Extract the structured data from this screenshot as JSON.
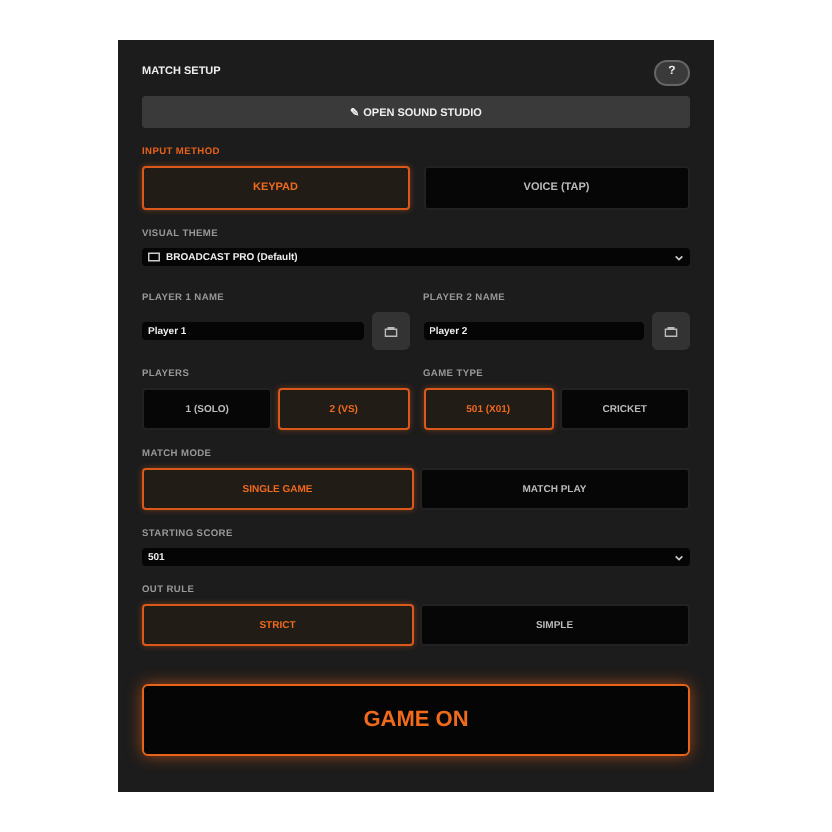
{
  "title": "MATCH SETUP",
  "help_button": "?",
  "sound_button": {
    "icon": "✎",
    "label": "OPEN SOUND STUDIO"
  },
  "input_method": {
    "label": "INPUT METHOD",
    "options": [
      {
        "label": "KEYPAD",
        "selected": true
      },
      {
        "label": "VOICE (TAP)",
        "selected": false
      }
    ]
  },
  "visual_theme": {
    "label": "VISUAL THEME",
    "value": "BROADCAST PRO (Default)"
  },
  "player_names": [
    {
      "label": "PLAYER 1 NAME",
      "value": "Player 1"
    },
    {
      "label": "PLAYER 2 NAME",
      "value": "Player 2"
    }
  ],
  "players": {
    "label": "PLAYERS",
    "options": [
      {
        "label": "1 (SOLO)",
        "selected": false
      },
      {
        "label": "2 (VS)",
        "selected": true
      }
    ]
  },
  "game_type": {
    "label": "GAME TYPE",
    "options": [
      {
        "label": "501 (X01)",
        "selected": true
      },
      {
        "label": "CRICKET",
        "selected": false
      }
    ]
  },
  "match_mode": {
    "label": "MATCH MODE",
    "options": [
      {
        "label": "SINGLE GAME",
        "selected": true
      },
      {
        "label": "MATCH PLAY",
        "selected": false
      }
    ]
  },
  "starting_score": {
    "label": "STARTING SCORE",
    "value": "501"
  },
  "out_rule": {
    "label": "OUT RULE",
    "options": [
      {
        "label": "STRICT",
        "selected": true
      },
      {
        "label": "SIMPLE",
        "selected": false
      }
    ]
  },
  "start_button": "GAME ON"
}
